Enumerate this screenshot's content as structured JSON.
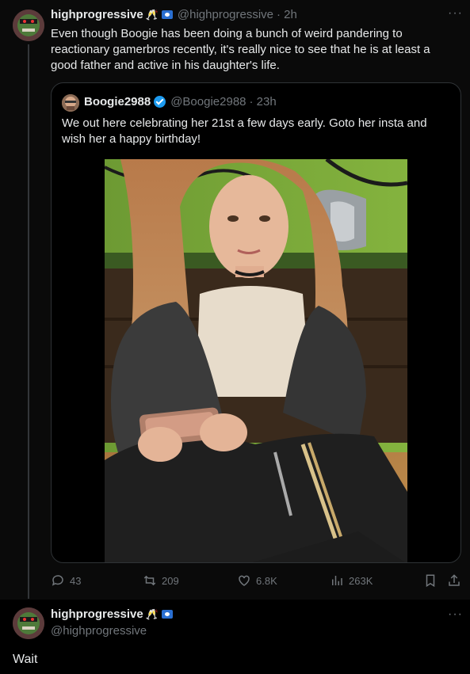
{
  "post1": {
    "author_name": "highprogressive",
    "emoji": "🥂",
    "handle": "@highprogressive",
    "time": "· 2h",
    "more": "···",
    "text": "Even though Boogie has been doing a bunch of weird pandering to reactionary gamerbros recently, it's really nice to see that he is at least a good father and active in his daughter's life.",
    "actions": {
      "replies": "43",
      "reposts": "209",
      "likes": "6.8K",
      "views": "263K"
    }
  },
  "quote": {
    "author_name": "Boogie2988",
    "handle": "@Boogie2988",
    "time": "· 23h",
    "text": "We out here celebrating her 21st a few days early. Goto her insta and wish her a happy birthday!"
  },
  "post2": {
    "author_name": "highprogressive",
    "emoji": "🥂",
    "handle": "@highprogressive",
    "more": "···",
    "text": "Wait"
  }
}
